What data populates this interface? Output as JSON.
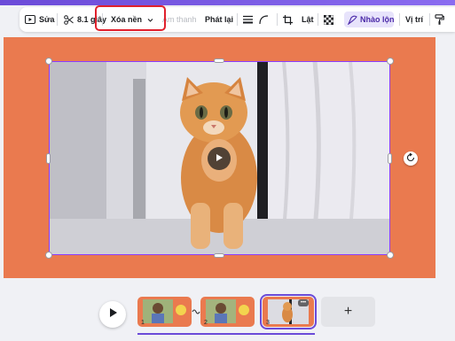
{
  "toolbar": {
    "edit_label": "Sửa",
    "duration_label": "8.1 giây",
    "remove_bg_label": "Xóa nền",
    "audio_label": "Âm thanh",
    "playback_label": "Phát lại",
    "flip_label": "Lật",
    "blend_label": "Nhào lộn",
    "position_label": "Vị trí"
  },
  "timeline": {
    "clips": [
      {
        "number": "1",
        "thumb": "child"
      },
      {
        "number": "2",
        "thumb": "child"
      },
      {
        "number": "3",
        "thumb": "cat",
        "more": "•••"
      }
    ],
    "add_label": "+"
  },
  "colors": {
    "canvas_bg": "#ea7a4f",
    "accent": "#8b3dff",
    "highlight": "#e0212d"
  },
  "icons": [
    "video-edit-icon",
    "scissors-icon",
    "chevron-down-icon",
    "lines-icon",
    "curve-icon",
    "crop-icon",
    "transparency-icon",
    "blend-icon",
    "paint-roller-icon",
    "play-icon",
    "rotate-icon",
    "transition-icon"
  ]
}
